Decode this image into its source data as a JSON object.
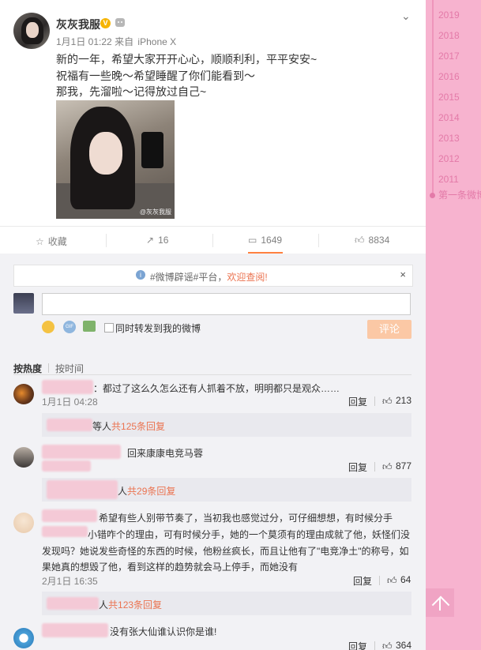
{
  "post": {
    "username": "灰灰我服",
    "badge": "V",
    "time": "1月1日 01:22",
    "source_prefix": "来自",
    "device": "iPhone X",
    "lines": [
      "新的一年，希望大家开开心心，顺顺利利，平平安安~",
      "祝福有一些晚～希望睡醒了你们能看到～",
      "那我，先溜啦～记得放过自己~"
    ],
    "photo_watermark": "@灰灰我服"
  },
  "actions": {
    "collect": "收藏",
    "forward": "16",
    "comment": "1649",
    "like": "8834"
  },
  "notice": {
    "prefix": "#微博辟谣#平台，",
    "highlight": "欢迎查阅!",
    "close": "×"
  },
  "composer": {
    "placeholder": "",
    "forward_label": "同时转发到我的微博",
    "send_label": "评论"
  },
  "sort": {
    "hot": "按热度",
    "time": "按时间"
  },
  "comments": [
    {
      "text": "：都过了这么久怎么还有人抓着不放，明明都只是观众……",
      "time": "1月1日 04:28",
      "reply": "回复",
      "likes": "213",
      "sub_text": "等人",
      "sub_count": "共125条回复"
    },
    {
      "text": "回来康康电竞马蓉",
      "time": "",
      "reply": "回复",
      "likes": "877",
      "sub_text": "人",
      "sub_count": "共29条回复"
    },
    {
      "lines": [
        "希望有些人别带节奏了，当初我也感觉过分，可仔细想想，有时候分手",
        "小错咋个的理由，可有时候分手，她的一个莫须有的理由成就了他，妖怪们没",
        "发现吗？她说发些奇怪的东西的时候，他粉丝疯长，而且让他有了\"电竞净土\"的称号，如",
        "果她真的想毁了他，看到这样的趋势就会马上停手，而她没有"
      ],
      "time": "2月1日 16:35",
      "reply": "回复",
      "likes": "64",
      "sub_text": "人",
      "sub_count": "共123条回复"
    },
    {
      "text": "没有张大仙谁认识你是谁!",
      "reply": "回复",
      "likes": "364"
    }
  ],
  "timeline": {
    "years": [
      "2019",
      "2018",
      "2017",
      "2016",
      "2015",
      "2014",
      "2013",
      "2012",
      "2011"
    ],
    "first": "第一条微博"
  },
  "colors": {
    "accent": "#eb7350",
    "sidebar_pink": "#f7b3cf",
    "send_button": "#fbc8a5"
  }
}
